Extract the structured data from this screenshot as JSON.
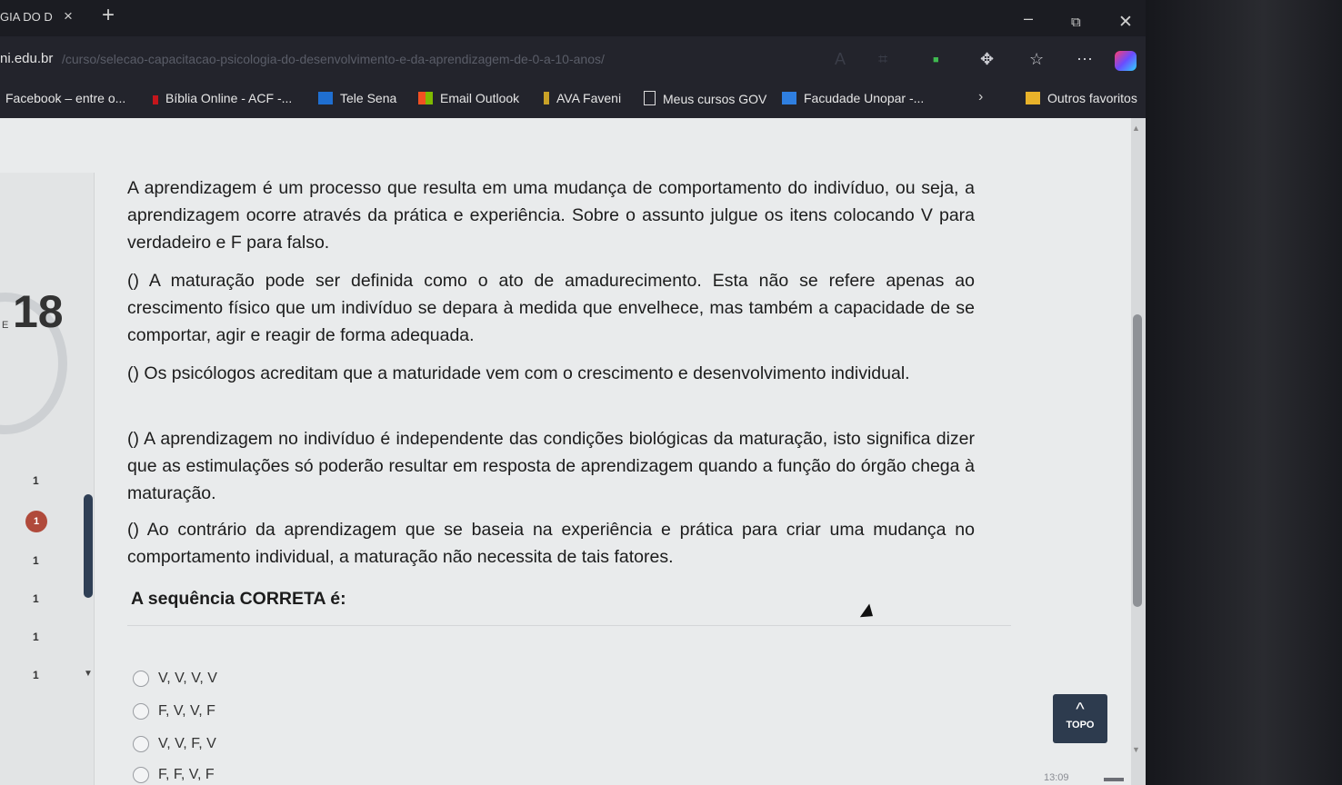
{
  "browser": {
    "tab_title": "GIA DO D",
    "tab_close": "×",
    "new_tab": "+",
    "window_minimize": "–",
    "window_restore": "⧉",
    "window_close": "✕",
    "url_host": "ni.edu.br",
    "url_path": "/curso/selecao-capacitacao-psicologia-do-desenvolvimento-e-da-aprendizagem-de-0-a-10-anos/",
    "toolbar_icons": [
      "read-aloud-icon",
      "translate-icon",
      "extension-icon",
      "puzzle-icon",
      "favorites-icon",
      "profile-icon",
      "copilot-icon"
    ],
    "bookmarks": [
      {
        "label": "Facebook – entre o...",
        "icon": "facebook-icon"
      },
      {
        "label": "Bíblia Online - ACF -...",
        "icon": "bible-icon"
      },
      {
        "label": "Tele Sena",
        "icon": "tele-sena-icon"
      },
      {
        "label": "Email Outlook",
        "icon": "outlook-icon"
      },
      {
        "label": "AVA Faveni",
        "icon": "faveni-icon"
      },
      {
        "label": "Meus cursos GOV",
        "icon": "document-icon"
      },
      {
        "label": "Facudade Unopar -...",
        "icon": "unopar-icon"
      }
    ],
    "bookmarks_more": "›",
    "other_favorites": "Outros favoritos"
  },
  "quiz": {
    "question_number": "18",
    "panel_label": "E",
    "nav_items": [
      "1",
      "1",
      "1",
      "1",
      "1",
      "1"
    ],
    "current_item": "1",
    "paragraphs": [
      "A aprendizagem é um processo que resulta em uma mudança de comportamento do indivíduo, ou seja, a aprendizagem ocorre através da prática e experiência. Sobre o assunto julgue os itens colocando V para verdadeiro e F para falso.",
      "() A maturação pode ser definida como o ato de amadurecimento. Esta não se refere apenas ao crescimento físico que um indivíduo se depara à medida que envelhece, mas também a capacidade de se comportar, agir e reagir de forma adequada.",
      "() Os psicólogos acreditam que a maturidade vem com o crescimento e desenvolvimento individual.",
      "() A aprendizagem no indivíduo é independente das condições biológicas da maturação, isto significa dizer que as estimulações só poderão resultar em resposta de aprendizagem quando a função do órgão chega à maturação.",
      "() Ao contrário da aprendizagem que se baseia na experiência e prática para criar uma mudança no comportamento individual, a maturação não necessita de tais fatores."
    ],
    "sequence_label": "A sequência CORRETA é:",
    "options": [
      "V, V, V, V",
      "F, V, V, F",
      "V, V, F, V",
      "F, F, V, F"
    ]
  },
  "topo_button": {
    "arrow": "^",
    "label": "TOPO"
  },
  "taskbar": {
    "time": "13:09"
  }
}
